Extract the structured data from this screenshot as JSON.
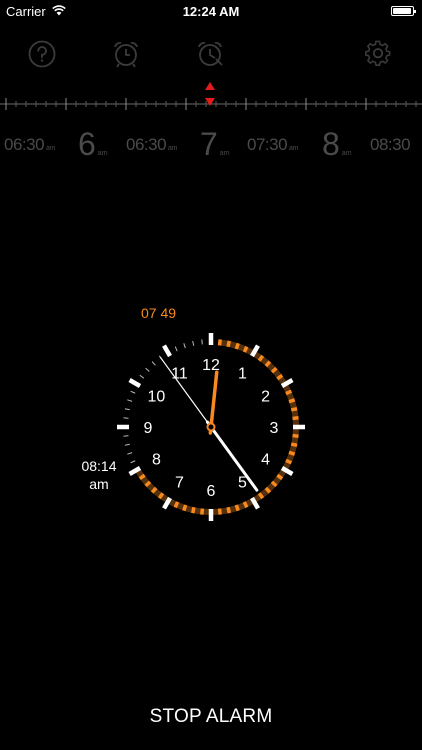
{
  "status_bar": {
    "carrier": "Carrier",
    "time": "12:24 AM",
    "battery_level": 0.95
  },
  "toolbar": {
    "icons": [
      "help-icon",
      "alarm-clock-icon",
      "alarm-clock-timer-icon",
      "settings-icon"
    ]
  },
  "ruler": {
    "labels": [
      {
        "text": "06:30",
        "ampm": "am",
        "size": "small"
      },
      {
        "text": "6",
        "ampm": "am",
        "size": "big"
      },
      {
        "text": "06:30",
        "ampm": "am",
        "size": "small"
      },
      {
        "text": "7",
        "ampm": "am",
        "size": "big"
      },
      {
        "text": "07:30",
        "ampm": "am",
        "size": "small"
      },
      {
        "text": "8",
        "ampm": "am",
        "size": "big"
      },
      {
        "text": "08:30",
        "ampm": "",
        "size": "small"
      }
    ]
  },
  "clock": {
    "alarm_time_label": "07 49",
    "side_time": "08:14",
    "side_ampm": "am",
    "numbers": [
      "12",
      "1",
      "2",
      "3",
      "4",
      "5",
      "6",
      "7",
      "8",
      "9",
      "10",
      "11"
    ],
    "hands": {
      "hour": 12.2,
      "minute": 24,
      "second": 54
    },
    "accent_color": "#f7891f"
  },
  "stop_alarm_label": "STOP ALARM"
}
